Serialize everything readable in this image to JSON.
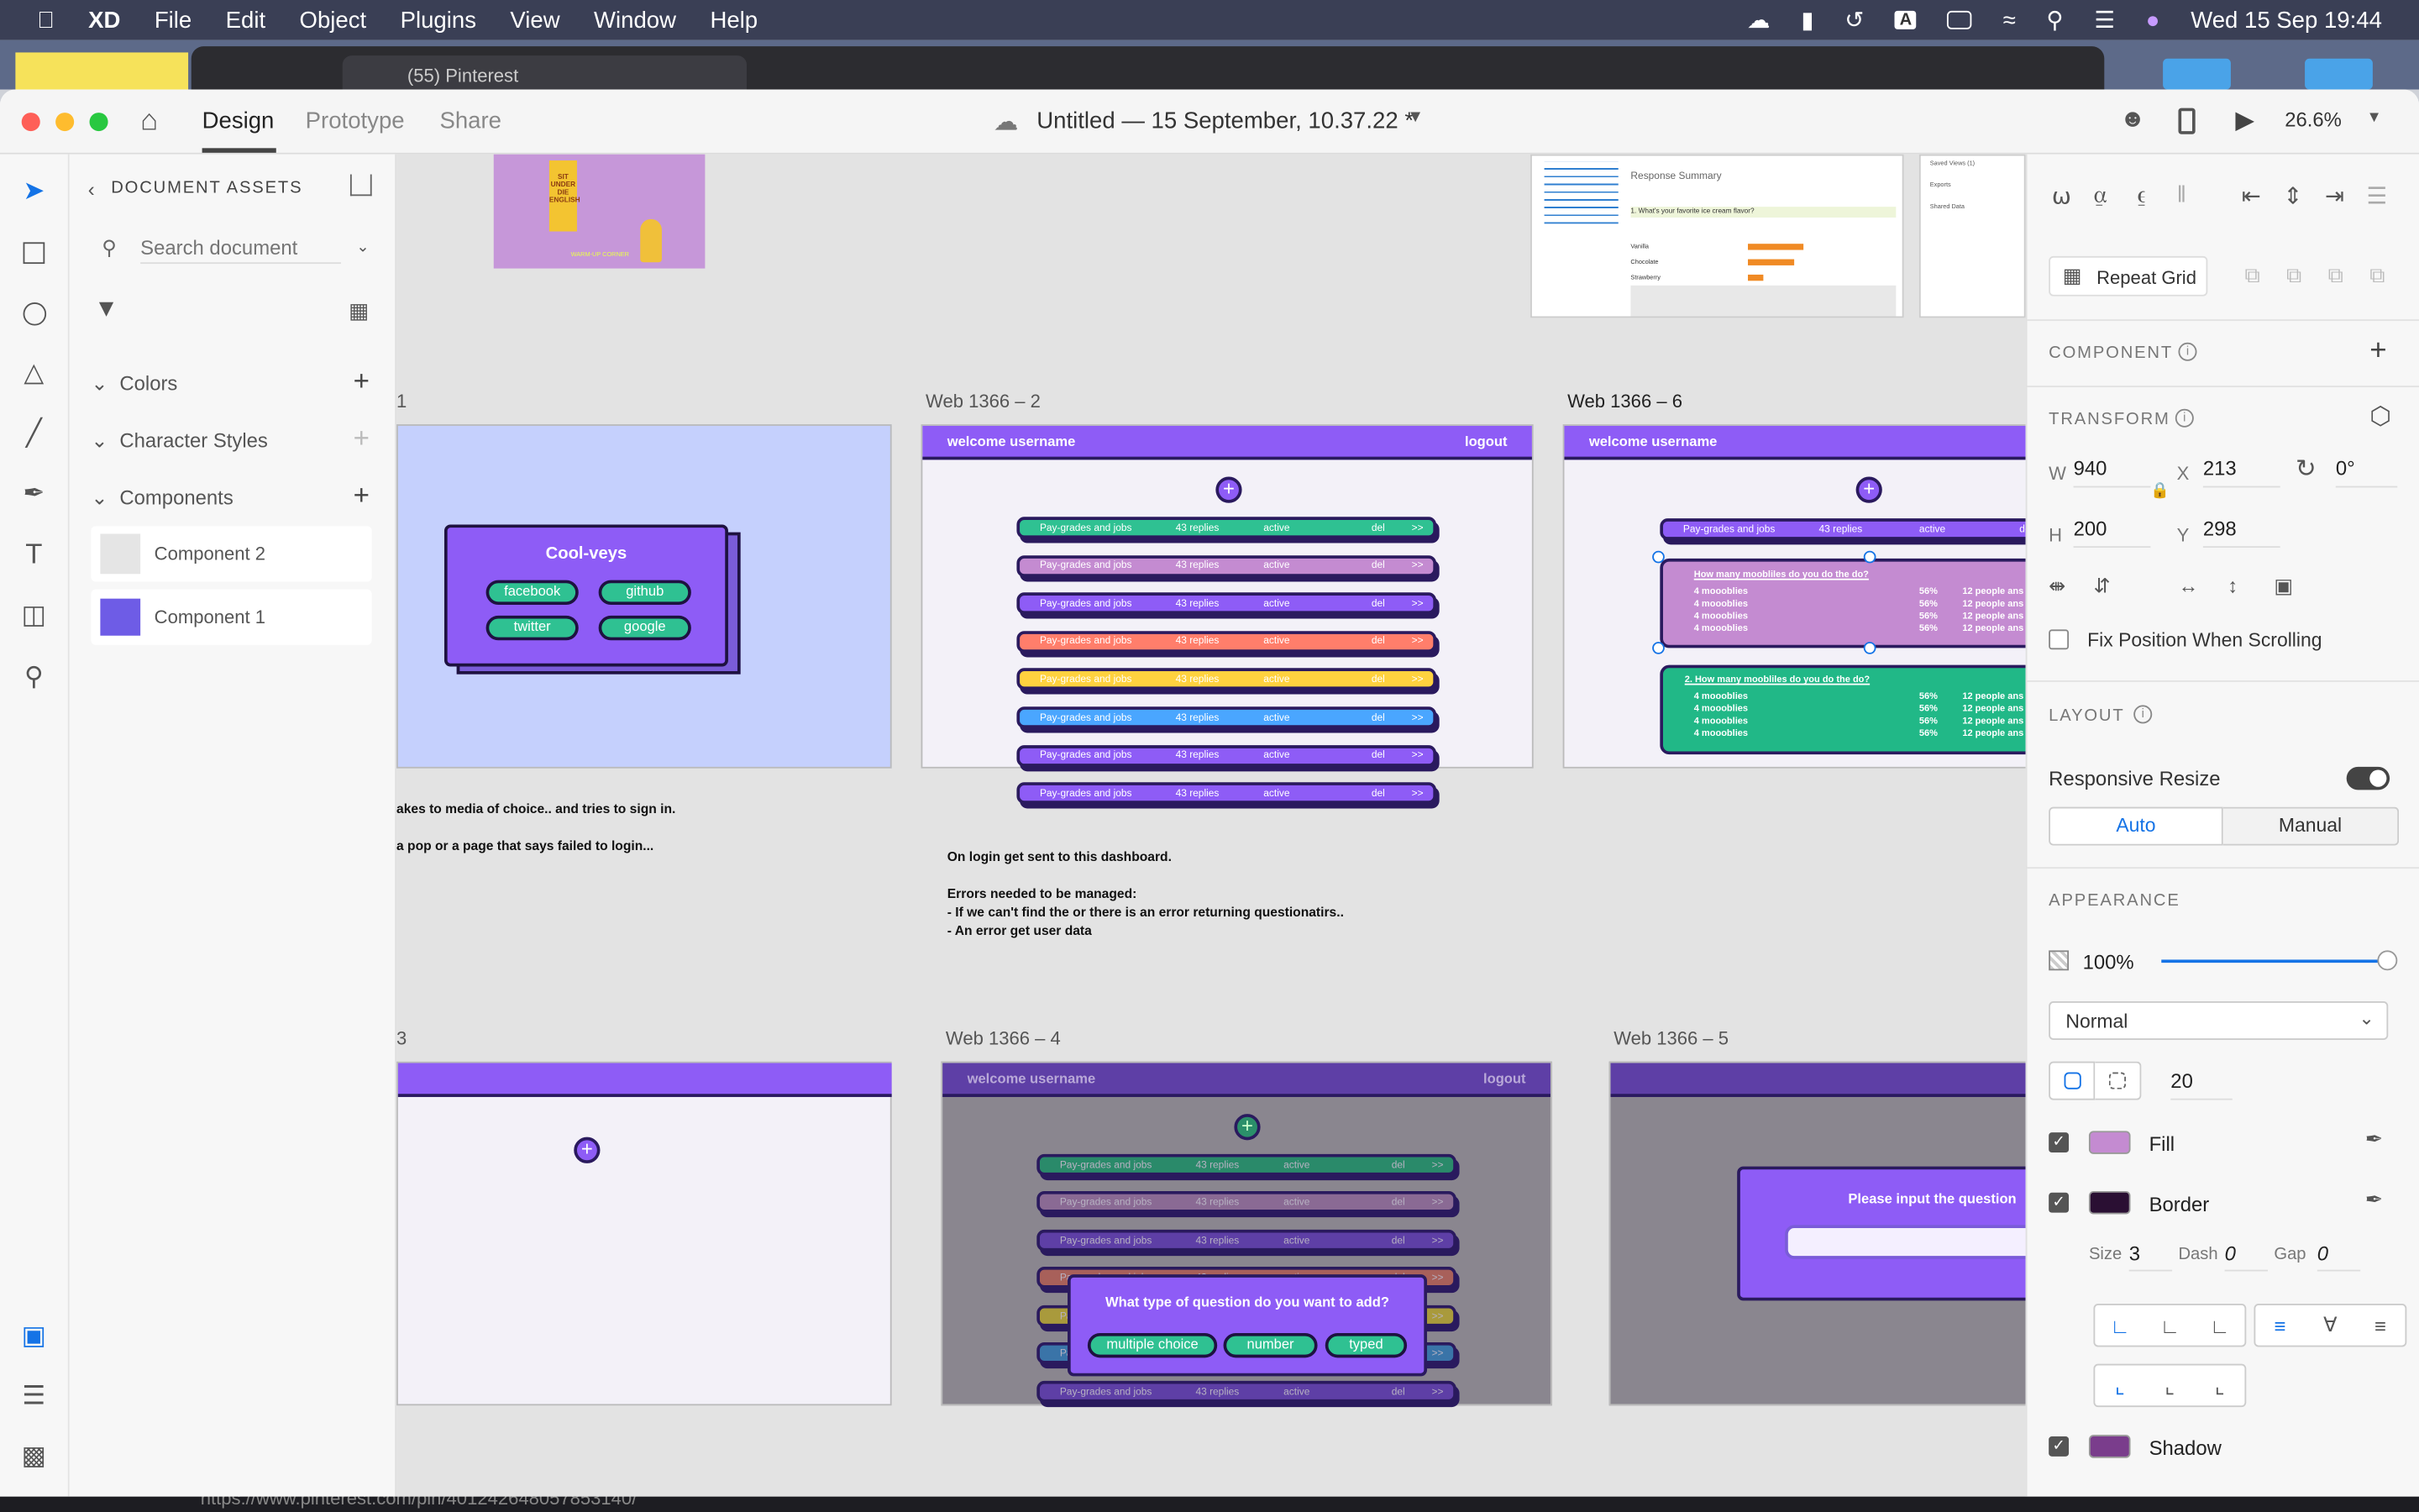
{
  "menubar": {
    "app": "XD",
    "items": [
      "File",
      "Edit",
      "Object",
      "Plugins",
      "View",
      "Window",
      "Help"
    ],
    "clock": "Wed 15 Sep  19:44"
  },
  "browser": {
    "tab": "(55) Pinterest",
    "url": "https://www.pinterest.com/pin/401242648057853140/"
  },
  "titlebar": {
    "tabs": [
      "Design",
      "Prototype",
      "Share"
    ],
    "doc_title": "Untitled — 15 September, 10.37.22 *",
    "zoom": "26.6%"
  },
  "assets": {
    "header": "DOCUMENT ASSETS",
    "search_placeholder": "Search document",
    "sections": [
      "Colors",
      "Character Styles",
      "Components"
    ],
    "components": [
      "Component 2",
      "Component 1"
    ]
  },
  "canvas": {
    "top_art": {
      "sign": "SIT\nUNDER\nDIE\nENGLISH",
      "caption": "WARM-UP CORNER"
    },
    "survey": {
      "title": "Response Summary",
      "question": "1. What's your favorite ice cream flavor?",
      "rows": [
        "Vanilla",
        "Chocolate",
        "Strawberry"
      ],
      "side": [
        "Saved Views (1)",
        "Exports",
        "Shared Data"
      ]
    },
    "ab1": {
      "title": "Cool-veys",
      "buttons": [
        "facebook",
        "github",
        "twitter",
        "google"
      ],
      "note": "akes to media of choice.. and tries to sign in.\n\na pop or a page that says failed to login..."
    },
    "ab2": {
      "label": "Web 1366 – 2",
      "welcome": "welcome username",
      "logout": "logout",
      "row": [
        "Pay-grades and jobs",
        "43 replies",
        "active",
        "del",
        ">>"
      ],
      "note": "On login get sent to this dashboard.\n\nErrors needed to be managed:\n- If we can't find the or there is an error returning questionatirs..\n- An error get user data"
    },
    "ab6": {
      "label": "Web 1366 – 6",
      "welcome": "welcome username",
      "q1": "How many moobliles do you do the do?",
      "q2": "2. How many moobliles do you do the do?",
      "opt": "4 moooblies",
      "pct": "56%",
      "ppl": "12 people ans"
    },
    "ab3": {
      "label": "3"
    },
    "ab4": {
      "label": "Web 1366 – 4",
      "welcome": "welcome username",
      "logout": "logout",
      "modal": "What type of question do you want to add?",
      "choices": [
        "multiple choice",
        "number",
        "typed"
      ]
    },
    "ab5": {
      "label": "Web 1366 – 5",
      "modal": "Please input the question"
    }
  },
  "rpanel": {
    "repeat_grid": "Repeat Grid",
    "component": "COMPONENT",
    "transform": "TRANSFORM",
    "w": "940",
    "x": "213",
    "rot": "0°",
    "h": "200",
    "y": "298",
    "fix_position": "Fix Position When Scrolling",
    "layout": "LAYOUT",
    "responsive": "Responsive Resize",
    "auto": "Auto",
    "manual": "Manual",
    "appearance": "APPEARANCE",
    "opacity": "100%",
    "blend": "Normal",
    "radius": "20",
    "fill": "Fill",
    "border": "Border",
    "size_label": "Size",
    "size": "3",
    "dash_label": "Dash",
    "dash": "0",
    "gap_label": "Gap",
    "gap": "0",
    "shadow": "Shadow"
  },
  "colors": {
    "accent": "#8e5cf6",
    "green": "#2fc192",
    "fill": "#c48bd1",
    "border": "#2a0f33",
    "shadow": "#7a3d8c"
  }
}
